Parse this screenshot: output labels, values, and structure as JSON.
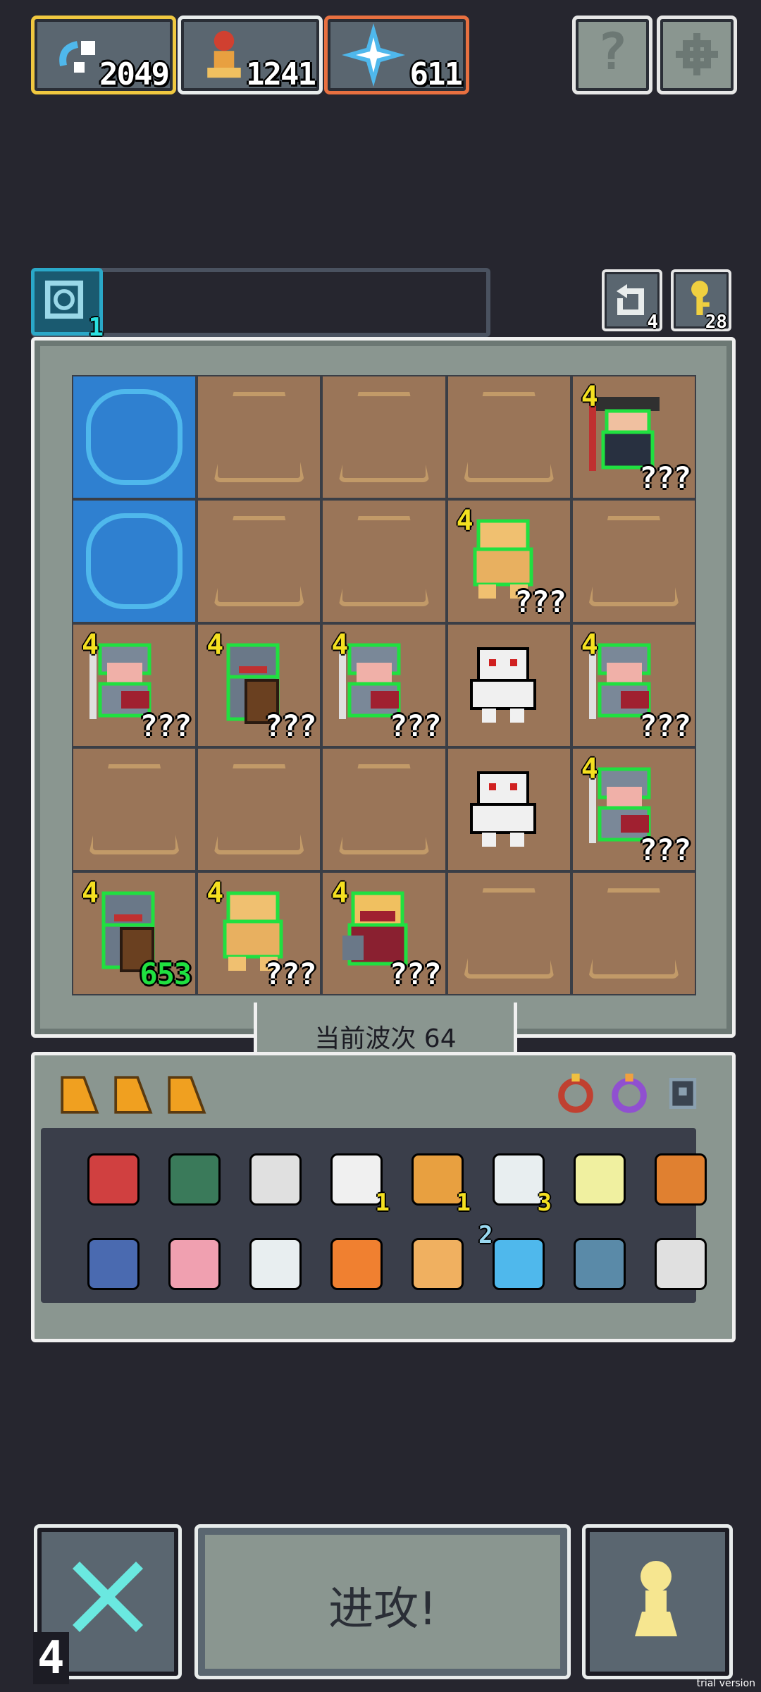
{
  "top_bar": {
    "resources": [
      {
        "name": "swirl-shard",
        "value": "2049"
      },
      {
        "name": "pawn-token",
        "value": "1241"
      },
      {
        "name": "star-burst",
        "value": "611"
      }
    ],
    "help_label": "?"
  },
  "status": {
    "timer_count": "1",
    "left_counter": "4",
    "right_counter": "28"
  },
  "board": {
    "cells": [
      {
        "terrain": "water",
        "unit": null
      },
      {
        "terrain": "dirt",
        "unit": null
      },
      {
        "terrain": "dirt",
        "unit": null
      },
      {
        "terrain": "dirt",
        "unit": null
      },
      {
        "terrain": "dirt",
        "unit": {
          "kind": "captain",
          "level": "4",
          "hp": "???"
        }
      },
      {
        "terrain": "water",
        "unit": null
      },
      {
        "terrain": "dirt",
        "unit": null
      },
      {
        "terrain": "dirt",
        "unit": null
      },
      {
        "terrain": "dirt",
        "unit": {
          "kind": "brute",
          "level": "4",
          "hp": "???"
        }
      },
      {
        "terrain": "dirt",
        "unit": null
      },
      {
        "terrain": "dirt",
        "unit": {
          "kind": "knight",
          "level": "4",
          "hp": "???"
        }
      },
      {
        "terrain": "dirt",
        "unit": {
          "kind": "shield-knight",
          "level": "4",
          "hp": "???"
        }
      },
      {
        "terrain": "dirt",
        "unit": {
          "kind": "knight",
          "level": "4",
          "hp": "???"
        }
      },
      {
        "terrain": "dirt",
        "unit": {
          "kind": "ghost",
          "level": "",
          "hp": ""
        }
      },
      {
        "terrain": "dirt",
        "unit": {
          "kind": "knight",
          "level": "4",
          "hp": "???"
        }
      },
      {
        "terrain": "dirt",
        "unit": null
      },
      {
        "terrain": "dirt",
        "unit": null
      },
      {
        "terrain": "dirt",
        "unit": null
      },
      {
        "terrain": "dirt",
        "unit": {
          "kind": "ghost",
          "level": "",
          "hp": ""
        }
      },
      {
        "terrain": "dirt",
        "unit": {
          "kind": "knight",
          "level": "4",
          "hp": "???"
        }
      },
      {
        "terrain": "dirt",
        "unit": {
          "kind": "shield-knight",
          "level": "4",
          "hp": "653",
          "hp_color": "green"
        }
      },
      {
        "terrain": "dirt",
        "unit": {
          "kind": "brute",
          "level": "4",
          "hp": "???"
        }
      },
      {
        "terrain": "dirt",
        "unit": {
          "kind": "bandit",
          "level": "4",
          "hp": "???"
        }
      },
      {
        "terrain": "dirt",
        "unit": null
      },
      {
        "terrain": "dirt",
        "unit": null
      }
    ]
  },
  "wave": {
    "label": "当前波次 64"
  },
  "inventory": {
    "cards": [
      "card",
      "card",
      "card"
    ],
    "rings": [
      "red-ring",
      "purple-ring",
      "dark-amulet"
    ],
    "row1": [
      {
        "icon": "beetle-charm",
        "count": ""
      },
      {
        "icon": "turtle-shell",
        "count": ""
      },
      {
        "icon": "scroll",
        "count": ""
      },
      {
        "icon": "dice",
        "count": "1"
      },
      {
        "icon": "pawn-figure",
        "count": "1"
      },
      {
        "icon": "cloud",
        "count": "3"
      },
      {
        "icon": "potion-flask",
        "count": ""
      },
      {
        "icon": "mushroom-hook",
        "count": ""
      }
    ],
    "row2": [
      {
        "icon": "portal-frame",
        "count": ""
      },
      {
        "icon": "peach",
        "count": ""
      },
      {
        "icon": "wing",
        "count": ""
      },
      {
        "icon": "meteor",
        "count": ""
      },
      {
        "icon": "gear-ring",
        "count": ""
      },
      {
        "icon": "swirl",
        "count": "2"
      },
      {
        "icon": "crystal-orb",
        "count": ""
      },
      {
        "icon": "hook",
        "count": ""
      }
    ]
  },
  "bottom": {
    "cancel_count": "4",
    "attack_label": "进攻!"
  },
  "watermark": "trial version"
}
